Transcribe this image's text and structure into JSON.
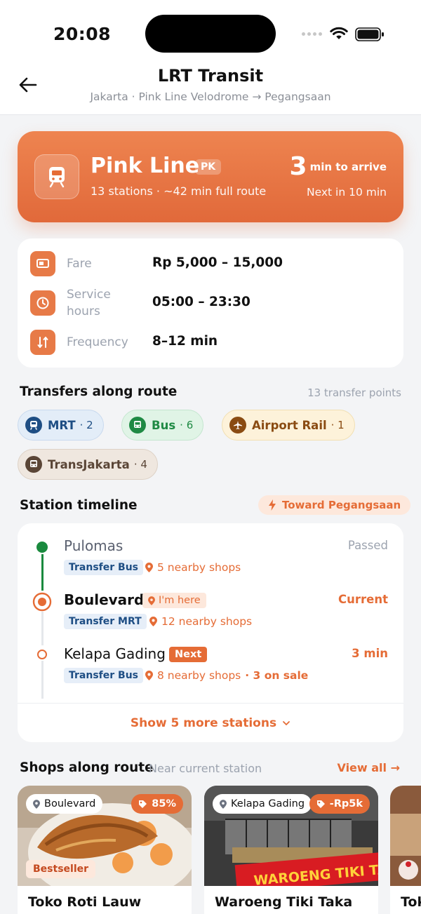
{
  "status_bar": {
    "time": "20:08"
  },
  "header": {
    "title": "LRT Transit",
    "subtitle": "Jakarta · Pink Line Velodrome → Pegangsaan"
  },
  "line": {
    "name": "Pink Line",
    "code": "PK",
    "meta": "13 stations · ~42 min full route",
    "eta_value": "3",
    "eta_label": "min to arrive",
    "next": "Next in 10 min",
    "icon": "train-icon"
  },
  "info": {
    "fare_label": "Fare",
    "fare_value": "Rp 5,000 – 15,000",
    "hours_label_1": "Service",
    "hours_label_2": "hours",
    "hours_value": "05:00 – 23:30",
    "frequency_label": "Frequency",
    "frequency_value": "8–12 min"
  },
  "transfers": {
    "title": "Transfers along route",
    "count_text": "13 transfer points",
    "chips": [
      {
        "label": "MRT",
        "count": "· 2",
        "icon": "train-icon"
      },
      {
        "label": "Bus",
        "count": "· 6",
        "icon": "bus-icon"
      },
      {
        "label": "Airport Rail",
        "count": "· 1",
        "icon": "plane-icon"
      },
      {
        "label": "TransJakarta",
        "count": "· 4",
        "icon": "bus-icon"
      }
    ]
  },
  "timeline": {
    "title": "Station timeline",
    "direction": "Toward Pegangsaan",
    "stations": [
      {
        "name": "Pulomas",
        "status": "Passed",
        "transfer": "Transfer Bus",
        "shops": "5 nearby shops",
        "state": "passed"
      },
      {
        "name": "Boulevard",
        "status": "Current",
        "transfer": "Transfer MRT",
        "shops": "12 nearby shops",
        "tag": "I'm here",
        "state": "current"
      },
      {
        "name": "Kelapa Gading",
        "status": "3 min",
        "transfer": "Transfer Bus",
        "shops": "8 nearby shops",
        "sale": "· 3 on sale",
        "tag": "Next",
        "state": "next"
      }
    ],
    "show_more": "Show 5 more stations"
  },
  "shops": {
    "title": "Shops along route",
    "subtitle": "Near current station",
    "view_all": "View all →",
    "cards": [
      {
        "station": "Boulevard",
        "discount": "85%",
        "badge": "Bestseller",
        "name": "Toko Roti Lauw"
      },
      {
        "station": "Kelapa Gading",
        "discount": "-Rp5k",
        "name": "Waroeng Tiki Taka",
        "sign_text": "WAROENG TIKI TAKA"
      },
      {
        "name": "Tok"
      }
    ]
  },
  "colors": {
    "accent": "#e56c36",
    "mrt": "#1e4e84",
    "bus": "#1f8a44",
    "airport": "#8a4b12",
    "transjakarta": "#5a4536",
    "passed": "#1a8a3e"
  }
}
